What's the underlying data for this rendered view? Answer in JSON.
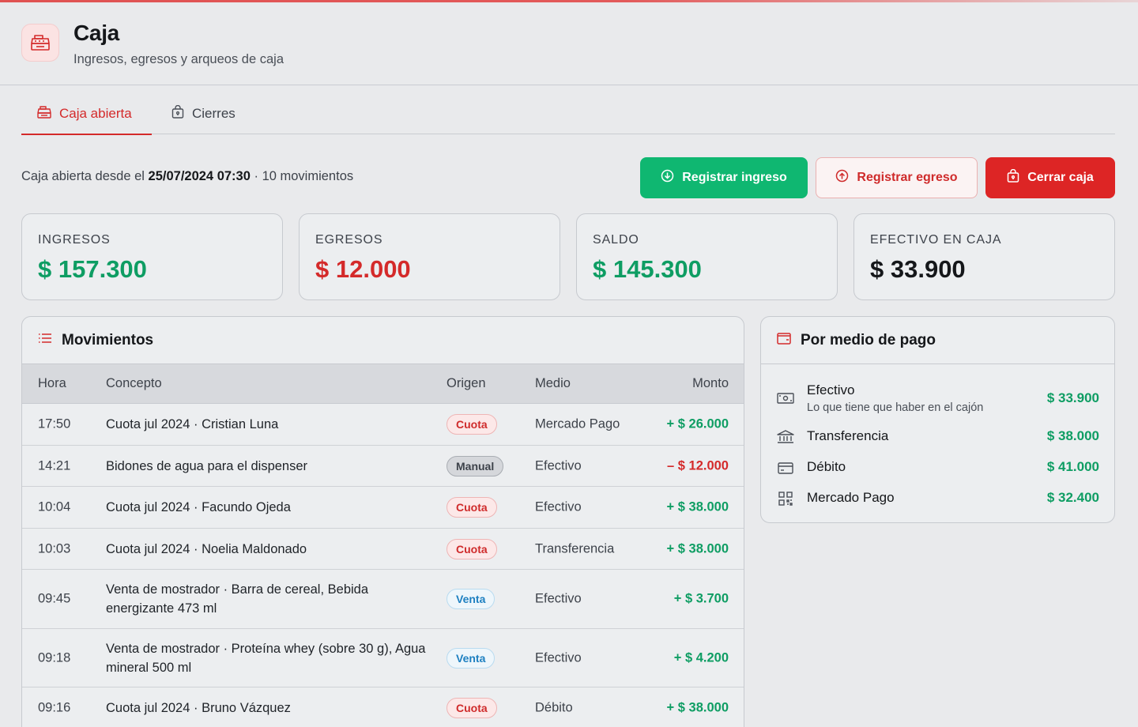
{
  "header": {
    "title": "Caja",
    "subtitle": "Ingresos, egresos y arqueos de caja"
  },
  "tabs": [
    {
      "label": "Caja abierta",
      "active": true
    },
    {
      "label": "Cierres",
      "active": false
    }
  ],
  "status": {
    "prefix": "Caja abierta desde el ",
    "datetime": "25/07/2024 07:30",
    "suffix": " · 10 movimientos"
  },
  "actions": {
    "ingreso_label": "Registrar ingreso",
    "egreso_label": "Registrar egreso",
    "cerrar_label": "Cerrar caja"
  },
  "stats": [
    {
      "label": "INGRESOS",
      "value": "$ 157.300",
      "color": "#0e9d63"
    },
    {
      "label": "EGRESOS",
      "value": "$ 12.000",
      "color": "#d42a2a"
    },
    {
      "label": "SALDO",
      "value": "$ 145.300",
      "color": "#0e9d63"
    },
    {
      "label": "EFECTIVO EN CAJA",
      "value": "$ 33.900",
      "color": "#15171a"
    }
  ],
  "movimientos": {
    "title": "Movimientos",
    "columns": {
      "hora": "Hora",
      "concepto": "Concepto",
      "origen": "Origen",
      "medio": "Medio",
      "monto": "Monto"
    },
    "rows": [
      {
        "hora": "17:50",
        "concepto": "Cuota jul 2024 · Cristian Luna",
        "origen": "Cuota",
        "medio": "Mercado Pago",
        "monto": "+ $ 26.000"
      },
      {
        "hora": "14:21",
        "concepto": "Bidones de agua para el dispenser",
        "origen": "Manual",
        "medio": "Efectivo",
        "monto": "– $ 12.000"
      },
      {
        "hora": "10:04",
        "concepto": "Cuota jul 2024 · Facundo Ojeda",
        "origen": "Cuota",
        "medio": "Efectivo",
        "monto": "+ $ 38.000"
      },
      {
        "hora": "10:03",
        "concepto": "Cuota jul 2024 · Noelia Maldonado",
        "origen": "Cuota",
        "medio": "Transferencia",
        "monto": "+ $ 38.000"
      },
      {
        "hora": "09:45",
        "concepto": "Venta de mostrador · Barra de cereal, Bebida energizante 473 ml",
        "origen": "Venta",
        "medio": "Efectivo",
        "monto": "+ $ 3.700"
      },
      {
        "hora": "09:18",
        "concepto": "Venta de mostrador · Proteína whey (sobre 30 g), Agua mineral 500 ml",
        "origen": "Venta",
        "medio": "Efectivo",
        "monto": "+ $ 4.200"
      },
      {
        "hora": "09:16",
        "concepto": "Cuota jul 2024 · Bruno Vázquez",
        "origen": "Cuota",
        "medio": "Débito",
        "monto": "+ $ 38.000"
      }
    ]
  },
  "medios": {
    "title": "Por medio de pago",
    "items": [
      {
        "label": "Efectivo",
        "sub": "Lo que tiene que haber en el cajón",
        "amount": "$ 33.900",
        "icon": "cash-icon"
      },
      {
        "label": "Transferencia",
        "amount": "$ 38.000",
        "icon": "bank-icon"
      },
      {
        "label": "Débito",
        "amount": "$ 41.000",
        "icon": "card-icon"
      },
      {
        "label": "Mercado Pago",
        "amount": "$ 32.400",
        "icon": "qr-icon"
      }
    ]
  },
  "colors": {
    "accent_red": "#d42a2a",
    "green": "#0e9d63",
    "blue": "#1e80c1"
  }
}
